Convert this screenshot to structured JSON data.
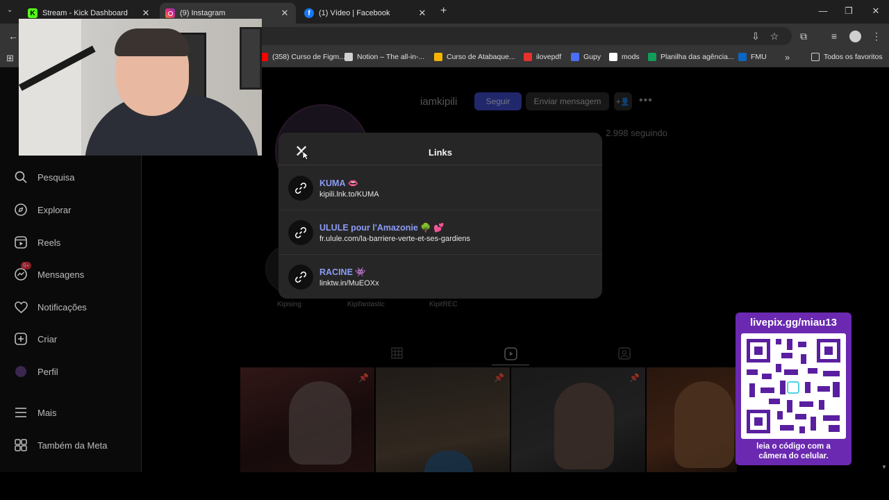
{
  "browser": {
    "tabs": [
      {
        "title": "Stream - Kick Dashboard",
        "icon": "kick-icon",
        "color": "#53fc18",
        "letter": "K",
        "active": false
      },
      {
        "title": "(9) Instagram",
        "icon": "instagram-icon",
        "color": "#e1306c",
        "letter": "",
        "active": true
      },
      {
        "title": "(1) Vídeo | Facebook",
        "icon": "facebook-icon",
        "color": "#1877f2",
        "letter": "f",
        "active": false
      }
    ],
    "new_tab": "+",
    "window_controls": {
      "minimize": "—",
      "restore": "❐",
      "close": "✕"
    },
    "bookmarks": [
      {
        "label": "(358) Curso de Figm...",
        "color": "#ff0000"
      },
      {
        "label": "Notion – The all-in-...",
        "color": "#d0d0d0"
      },
      {
        "label": "Curso de Atabaque...",
        "color": "#f4b400"
      },
      {
        "label": "ilovepdf",
        "color": "#e5322d"
      },
      {
        "label": "Gupy",
        "color": "#4c6ef5"
      },
      {
        "label": "mods",
        "color": "#ffffff"
      },
      {
        "label": "Planilha das agência...",
        "color": "#0f9d58"
      },
      {
        "label": "FMU",
        "color": "#0a66c2"
      }
    ],
    "bookmarks_more": "»",
    "all_favorites": "Todos os favoritos"
  },
  "sidebar": {
    "items": [
      {
        "label": "Pesquisa",
        "icon": "search-icon",
        "glyph": "⚲"
      },
      {
        "label": "Explorar",
        "icon": "compass-icon",
        "glyph": "◎"
      },
      {
        "label": "Reels",
        "icon": "reels-icon",
        "glyph": "▣"
      },
      {
        "label": "Mensagens",
        "icon": "messenger-icon",
        "glyph": "◌",
        "badge": "9+"
      },
      {
        "label": "Notificações",
        "icon": "heart-icon",
        "glyph": "♡"
      },
      {
        "label": "Criar",
        "icon": "plus-square-icon",
        "glyph": "⊞"
      },
      {
        "label": "Perfil",
        "icon": "avatar-icon",
        "glyph": "●"
      },
      {
        "label": "Mais",
        "icon": "menu-icon",
        "glyph": "≡"
      },
      {
        "label": "Também da Meta",
        "icon": "meta-icon",
        "glyph": "⧉"
      }
    ]
  },
  "profile": {
    "username": "iamkipili",
    "follow_label": "Seguir",
    "message_label": "Enviar mensagem",
    "following": "2.998 seguindo",
    "highlights": [
      "Kipising",
      "Kipifantastic",
      "KipitREC"
    ]
  },
  "modal": {
    "title": "Links",
    "close_glyph": "✕",
    "links": [
      {
        "title": "KUMA 👄",
        "url": "kipili.lnk.to/KUMA"
      },
      {
        "title": "ULULE pour l'Amazonie 🌳 💕",
        "url": "fr.ulule.com/la-barriere-verte-et-ses-gardiens"
      },
      {
        "title": "RACINE 👾",
        "url": "linktw.in/MuEOXx"
      }
    ]
  },
  "qr": {
    "url": "livepix.gg/miau13",
    "caption_line1": "leia o código com a",
    "caption_line2": "câmera do celular."
  }
}
